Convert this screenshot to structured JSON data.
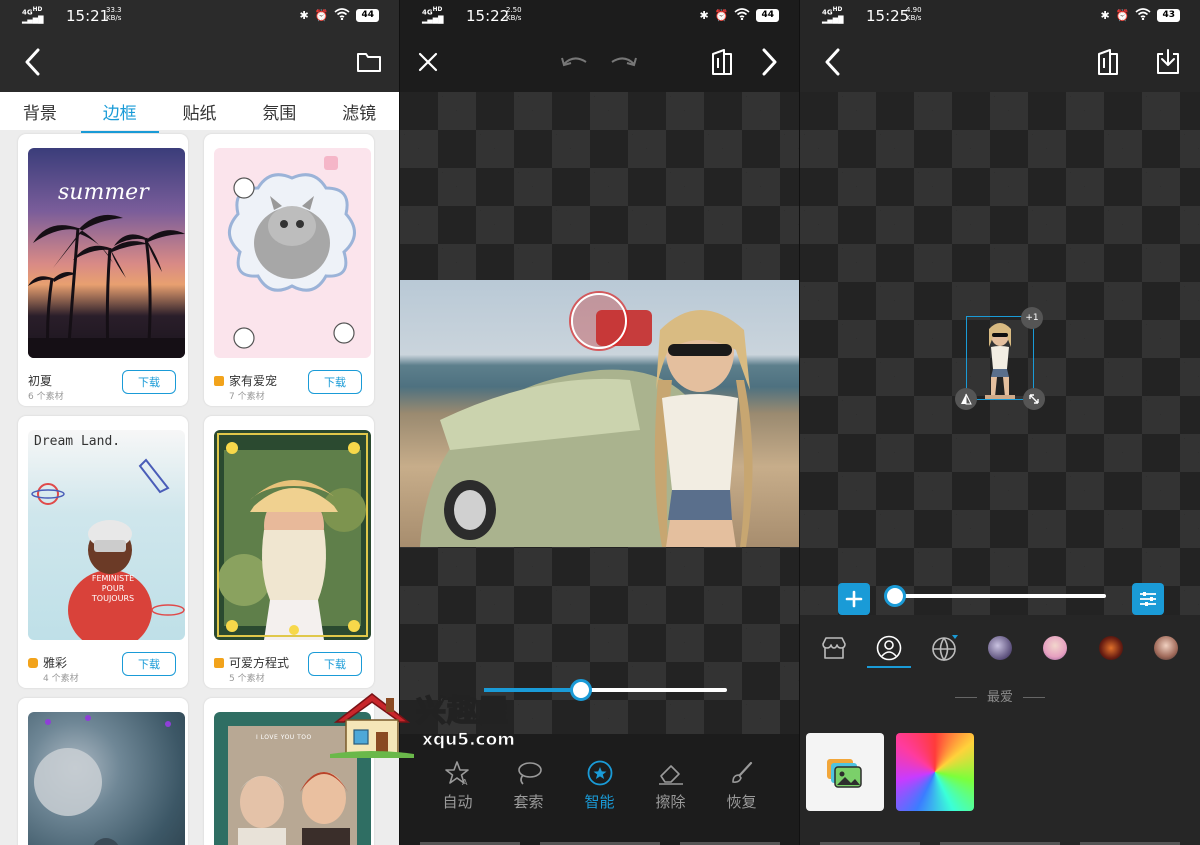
{
  "screen1": {
    "status": {
      "net": "4G HD",
      "time": "15:21",
      "speed_value": "33.3",
      "speed_unit": "KB/s",
      "battery": "44"
    },
    "tabs": [
      {
        "label": "背景"
      },
      {
        "label": "边框"
      },
      {
        "label": "贴纸"
      },
      {
        "label": "氛围"
      },
      {
        "label": "滤镜"
      }
    ],
    "active_tab": "边框",
    "cards": [
      {
        "name": "初夏",
        "count": "6 个素材",
        "download": "下载",
        "thumb_text": "summer",
        "badge": ""
      },
      {
        "name": "家有爱宠",
        "count": "7 个素材",
        "download": "下载",
        "badge": "vip"
      },
      {
        "name": "雅彩",
        "count": "4 个素材",
        "download": "下载",
        "thumb_text": "Dream Land.",
        "shirt_text": "FEMINISTE POUR TOUJOURS",
        "badge": "play"
      },
      {
        "name": "可爱方程式",
        "count": "5 个素材",
        "download": "下载",
        "badge": "vip"
      }
    ],
    "partial_card_text": "I LOVE YOU TOO"
  },
  "screen2": {
    "status": {
      "net": "4G HD",
      "time": "15:22",
      "speed_value": "2.50",
      "speed_unit": "KB/s",
      "battery": "44"
    },
    "slider_value": 0.4,
    "tools": [
      {
        "label": "自动",
        "icon": "star-auto-icon"
      },
      {
        "label": "套索",
        "icon": "lasso-icon"
      },
      {
        "label": "智能",
        "icon": "smart-star-icon"
      },
      {
        "label": "擦除",
        "icon": "eraser-icon"
      },
      {
        "label": "恢复",
        "icon": "brush-icon"
      }
    ],
    "active_tool": "智能"
  },
  "screen3": {
    "status": {
      "net": "4G HD",
      "time": "15:25",
      "speed_value": "4.90",
      "speed_unit": "KB/s",
      "battery": "43"
    },
    "plus_one": "+1",
    "slider_value": 0.0,
    "section_label": "最爱"
  },
  "watermark": {
    "title": "兴趣屋",
    "url": "xqu5.com"
  },
  "colors": {
    "accent": "#1a9bd7",
    "dark_bg": "#262626",
    "light_bg": "#ededed"
  }
}
